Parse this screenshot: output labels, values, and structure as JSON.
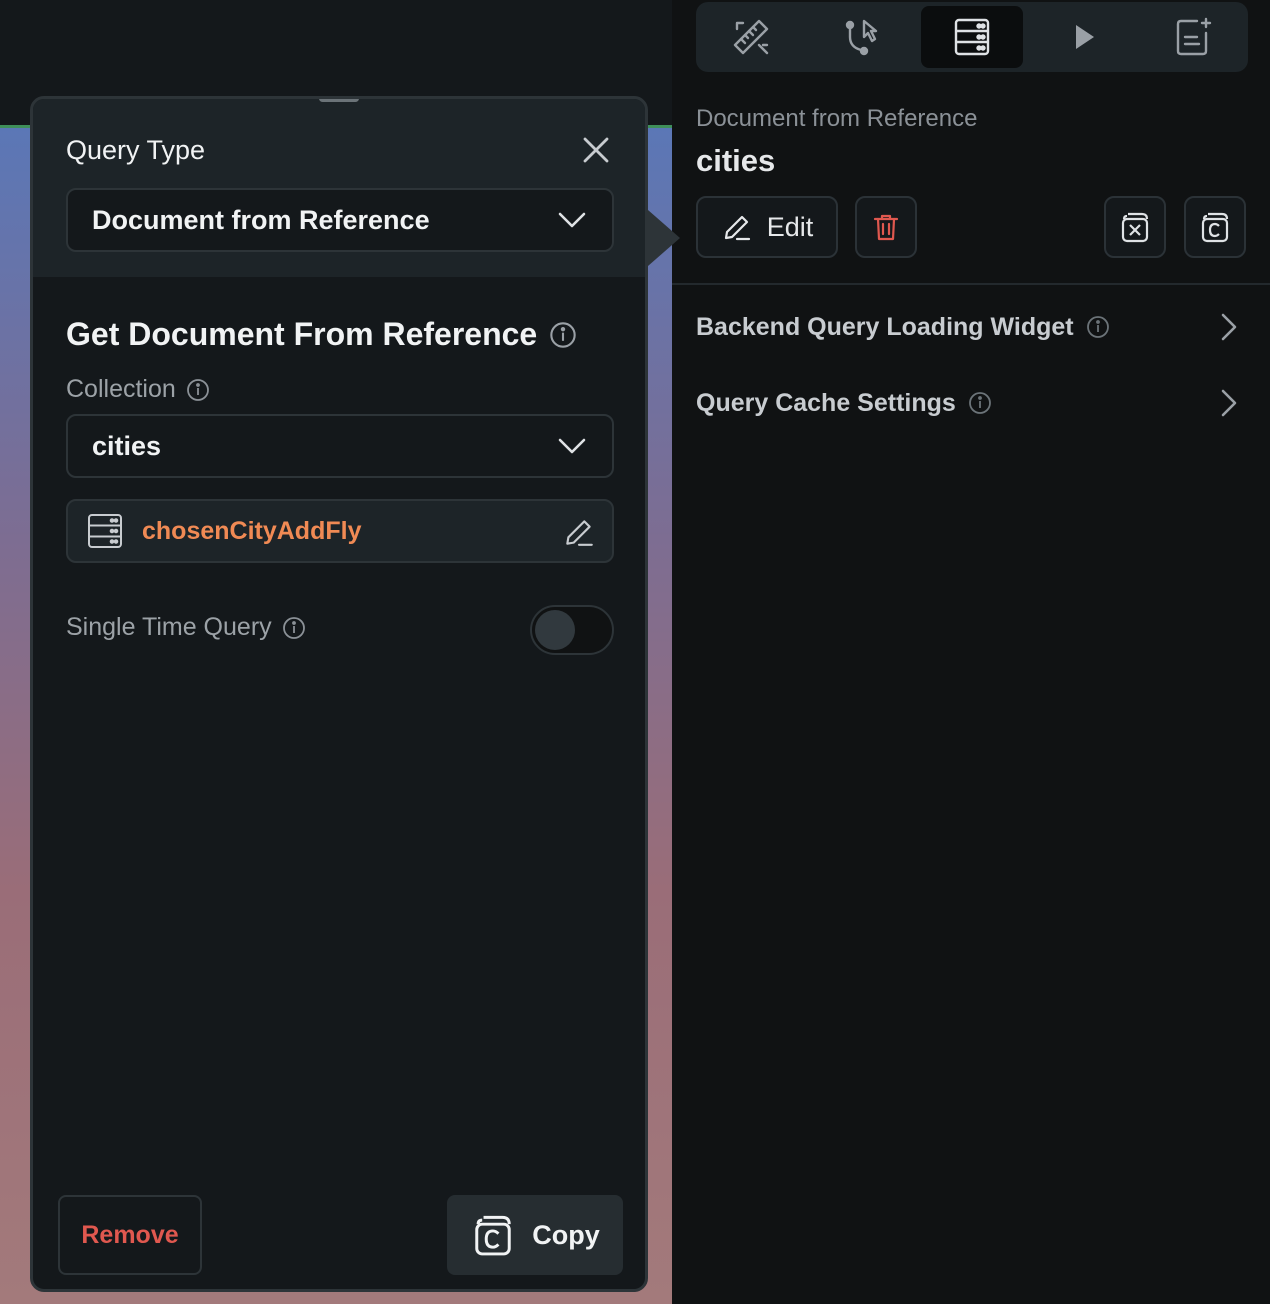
{
  "toolbar": {
    "tools": [
      {
        "icon": "design-tools-icon",
        "active": false
      },
      {
        "icon": "actions-flow-icon",
        "active": false
      },
      {
        "icon": "backend-query-icon",
        "active": true
      },
      {
        "icon": "play-icon",
        "active": false
      },
      {
        "icon": "add-document-icon",
        "active": false
      }
    ]
  },
  "right_panel": {
    "query_type_subtitle": "Document from Reference",
    "collection_title": "cities",
    "edit_label": "Edit",
    "rows": [
      {
        "label": "Backend Query Loading Widget"
      },
      {
        "label": "Query Cache Settings"
      }
    ]
  },
  "popup": {
    "query_type_label": "Query Type",
    "query_type_value": "Document from Reference",
    "section_title": "Get Document From Reference",
    "collection_label": "Collection",
    "collection_value": "cities",
    "reference_variable": "chosenCityAddFly",
    "single_time_query_label": "Single Time Query",
    "single_time_query_on": false,
    "remove_label": "Remove",
    "copy_label": "Copy"
  },
  "colors": {
    "accent_orange": "#f08a54",
    "danger_red": "#e0584f"
  }
}
